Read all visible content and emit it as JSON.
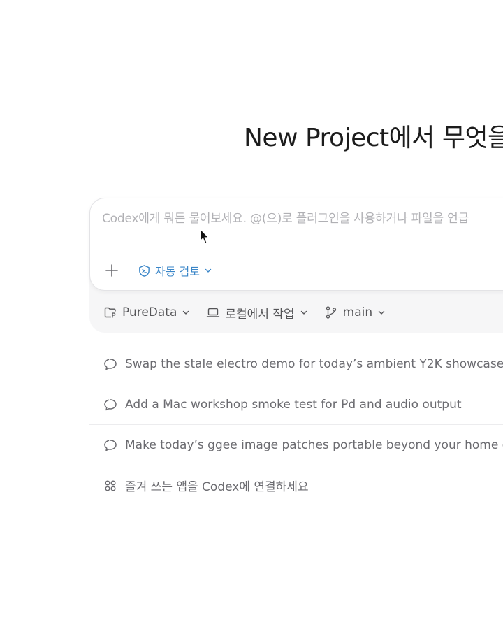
{
  "header": {
    "title": "New Project에서 무엇을"
  },
  "composer": {
    "placeholder": "Codex에게 뭐든 물어보세요. @(으)로 플러그인을 사용하거나 파일을 언급",
    "add_icon": "plus-icon",
    "review_label": "자동 검토",
    "review_icon": "review-shield-icon"
  },
  "footer": {
    "project_label": "PureData",
    "mode_label": "로컬에서 작업",
    "branch_label": "main"
  },
  "suggestions": [
    {
      "icon": "chat-bubble-icon",
      "label": "Swap the stale electro demo for today’s ambient Y2K showcase"
    },
    {
      "icon": "chat-bubble-icon",
      "label": "Add a Mac workshop smoke test for Pd and audio output"
    },
    {
      "icon": "chat-bubble-icon",
      "label": "Make today’s ggee image patches portable beyond your home d"
    },
    {
      "icon": "apps-grid-icon",
      "label": "즐겨 쓰는 앱을 Codex에 연결하세요"
    }
  ],
  "colors": {
    "accent": "#3a86c8",
    "placeholder": "#b0b0b4",
    "muted_text": "#6b6b70"
  }
}
